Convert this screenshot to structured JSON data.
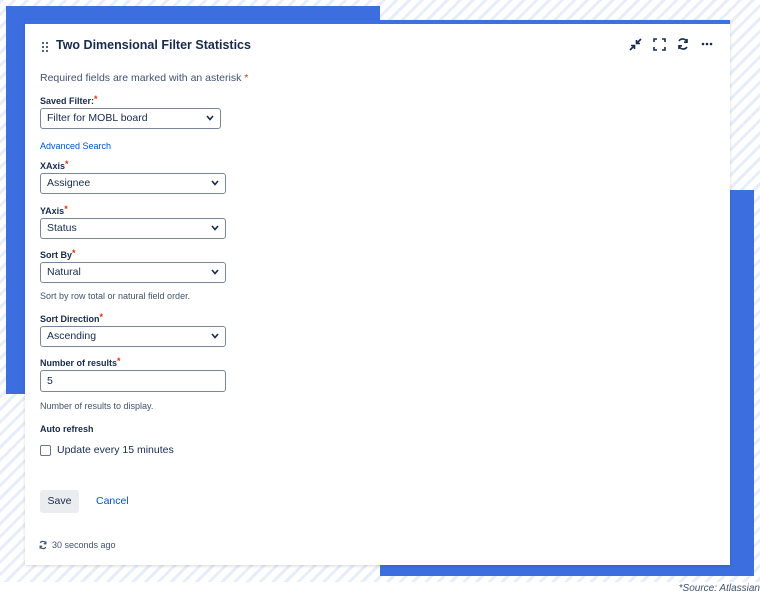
{
  "gadget": {
    "title": "Two Dimensional Filter Statistics",
    "required_note": "Required fields are marked with an asterisk",
    "required_star": "*"
  },
  "fields": {
    "saved_filter": {
      "label": "Saved Filter:",
      "value": "Filter for MOBL board"
    },
    "advanced_search": "Advanced Search",
    "xaxis": {
      "label": "XAxis",
      "value": "Assignee"
    },
    "yaxis": {
      "label": "YAxis",
      "value": "Status"
    },
    "sort_by": {
      "label": "Sort By",
      "value": "Natural",
      "help": "Sort by row total or natural field order."
    },
    "sort_direction": {
      "label": "Sort Direction",
      "value": "Ascending"
    },
    "number_of_results": {
      "label": "Number of results",
      "value": "5",
      "help": "Number of results to display."
    },
    "auto_refresh": {
      "label": "Auto refresh",
      "checkbox_label": "Update every 15 minutes",
      "checked": false
    }
  },
  "actions": {
    "save": "Save",
    "cancel": "Cancel"
  },
  "footer": {
    "refreshed": "30 seconds ago"
  },
  "source": "*Source: Atlassian",
  "icons": {
    "header": [
      "drag-handle-icon",
      "minimize-icon",
      "fullscreen-icon",
      "refresh-icon",
      "more-icon"
    ],
    "footer": "refresh-icon"
  },
  "colors": {
    "accent": "#3f70e0",
    "link": "#0052cc",
    "required": "#de350b",
    "text": "#172b4d"
  }
}
